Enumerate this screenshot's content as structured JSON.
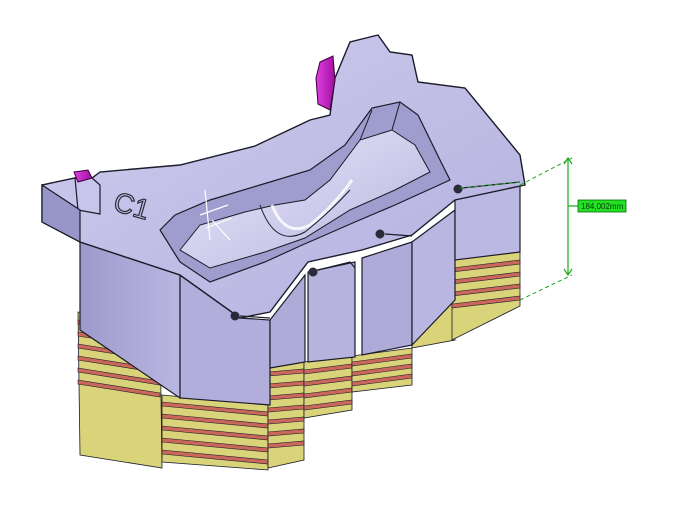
{
  "view": {
    "background": "#ffffff",
    "colors": {
      "body": "#a6a3d4",
      "body_light": "#c3c1e8",
      "body_dark": "#8b88bd",
      "edge": "#1b1b2a",
      "lamination_red": "#c9675a",
      "lamination_yellow": "#d9d37a",
      "pin_magenta": "#c820c8",
      "dimension_green": "#1aa81a",
      "dimension_label_bg": "#22e022"
    }
  },
  "part": {
    "mark": "C1"
  },
  "dimension": {
    "value": "184,002mm"
  }
}
